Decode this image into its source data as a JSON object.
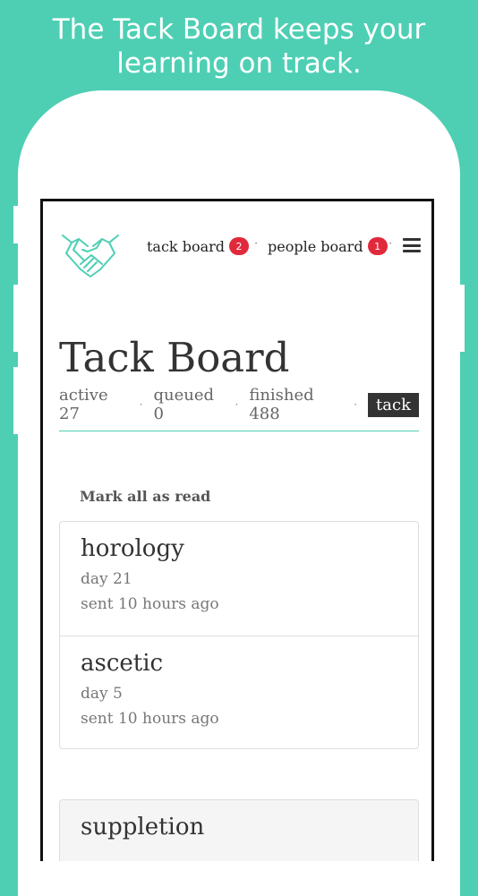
{
  "headline": "The Tack Board keeps your learning on track.",
  "nav": {
    "tack_board_label": "tack board",
    "tack_board_count": "2",
    "separator": "·",
    "people_board_label": "people board",
    "people_board_count": "1"
  },
  "page": {
    "title": "Tack Board",
    "stats": {
      "active": "active 27",
      "queued": "queued 0",
      "finished": "finished 488",
      "separator": "·"
    },
    "tack_button": "tack",
    "mark_all_read": "Mark all as read"
  },
  "cards": [
    {
      "word": "horology",
      "day": "day 21",
      "sent": "sent 10 hours ago"
    },
    {
      "word": "ascetic",
      "day": "day 5",
      "sent": "sent 10 hours ago"
    }
  ],
  "next_card": {
    "word": "suppletion"
  },
  "colors": {
    "background": "#4ecfb4",
    "badge": "#e02a3b",
    "logo_stroke": "#4ecfb4"
  }
}
